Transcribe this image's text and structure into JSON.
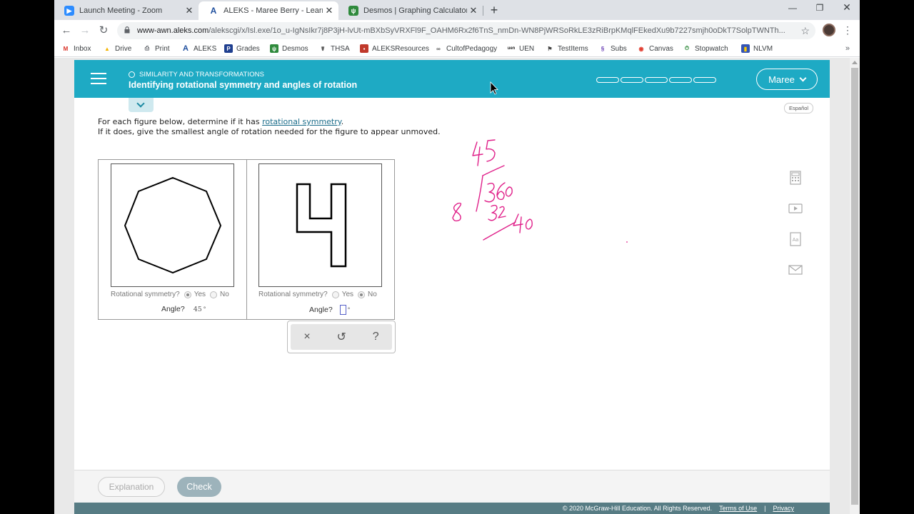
{
  "tabs": [
    {
      "title": "Launch Meeting - Zoom",
      "active": false,
      "icon": "zoom-icon"
    },
    {
      "title": "ALEKS - Maree Berry - Learn",
      "active": true,
      "icon": "aleks-icon"
    },
    {
      "title": "Desmos | Graphing Calculator",
      "active": false,
      "icon": "desmos-icon"
    }
  ],
  "address": {
    "url_host": "www-awn.aleks.com",
    "url_path": "/alekscgi/x/Isl.exe/1o_u-IgNsIkr7j8P3jH-lvUt-mBXbSyVRXFl9F_OAHM6Rx2f6TnS_nmDn-WN8PjWRSoRkLE3zRiBrpKMqlFEkedXu9b7227smjh0oDkT7SolpTWNTh..."
  },
  "bookmarks": [
    "Inbox",
    "Drive",
    "Print",
    "ALEKS",
    "Grades",
    "Desmos",
    "THSA",
    "ALEKSResources",
    "CultofPedagogy",
    "UEN",
    "TestItems",
    "Subs",
    "Canvas",
    "Stopwatch",
    "NLVM"
  ],
  "header": {
    "topic": "SIMILARITY AND TRANSFORMATIONS",
    "lesson": "Identifying rotational symmetry and angles of rotation",
    "progress_segments_filled": 0,
    "progress_segments_total": 5,
    "user": "Maree",
    "language_link": "Español"
  },
  "instructions": {
    "line1_before": "For each figure below, determine if it has ",
    "line1_link": "rotational symmetry",
    "line1_after": ".",
    "line2": "If it does, give the smallest angle of rotation needed for the figure to appear unmoved."
  },
  "figures": [
    {
      "shape": "regular octagon",
      "question": "Rotational symmetry?",
      "yes": "Yes",
      "no": "No",
      "selected": "Yes",
      "angle_label": "Angle?",
      "angle_value": "45",
      "deg": "°"
    },
    {
      "shape": "digit four",
      "question": "Rotational symmetry?",
      "yes": "Yes",
      "no": "No",
      "selected": "No",
      "angle_label": "Angle?",
      "angle_value": "",
      "deg": "°"
    }
  ],
  "keypad": {
    "clear": "×",
    "undo": "↺",
    "help": "?"
  },
  "tools": [
    "calculator-icon",
    "video-icon",
    "dictionary-icon",
    "message-icon"
  ],
  "buttons": {
    "explanation": "Explanation",
    "check": "Check"
  },
  "footer": {
    "copyright": "© 2020 McGraw-Hill Education. All Rights Reserved.",
    "terms": "Terms of Use",
    "sep": "|",
    "privacy": "Privacy"
  },
  "handwriting": {
    "color": "#e0218a",
    "quotient": "45",
    "divisor": "8",
    "dividend": "360",
    "subtract": "32",
    "remainder": "40"
  }
}
